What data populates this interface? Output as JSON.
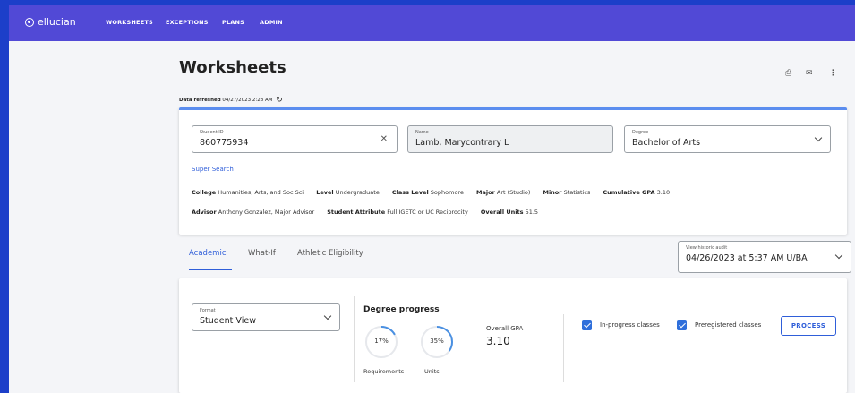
{
  "brand": {
    "name": "ellucian"
  },
  "nav": {
    "items": [
      "WORKSHEETS",
      "EXCEPTIONS",
      "PLANS",
      "ADMIN"
    ]
  },
  "page": {
    "title": "Worksheets",
    "refreshed_label": "Data refreshed",
    "refreshed_value": "04/27/2023 2:28 AM"
  },
  "student": {
    "id_label": "Student ID",
    "id_value": "860775934",
    "name_label": "Name",
    "name_value": "Lamb, Marycontrary L",
    "degree_label": "Degree",
    "degree_value": "Bachelor of Arts",
    "super_search": "Super Search",
    "row1": [
      {
        "key": "College",
        "value": "Humanities, Arts, and Soc Sci"
      },
      {
        "key": "Level",
        "value": "Undergraduate"
      },
      {
        "key": "Class Level",
        "value": "Sophomore"
      },
      {
        "key": "Major",
        "value": "Art (Studio)"
      },
      {
        "key": "Minor",
        "value": "Statistics"
      },
      {
        "key": "Cumulative GPA",
        "value": "3.10"
      }
    ],
    "row2": [
      {
        "key": "Advisor",
        "value": "Anthony Gonzalez, Major Advisor"
      },
      {
        "key": "Student Attribute",
        "value": "Full IGETC or UC Reciprocity"
      },
      {
        "key": "Overall Units",
        "value": "51.5"
      }
    ]
  },
  "tabs": {
    "items": [
      "Academic",
      "What-If",
      "Athletic Eligibility"
    ],
    "active": 0
  },
  "history": {
    "label": "View historic audit",
    "value": "04/26/2023 at 5:37 AM U/BA"
  },
  "audit": {
    "format_label": "Format",
    "format_value": "Student View",
    "progress_title": "Degree progress",
    "requirements_pct": "17%",
    "requirements_fraction": 0.17,
    "requirements_label": "Requirements",
    "units_pct": "35%",
    "units_fraction": 0.35,
    "units_label": "Units",
    "gpa_label": "Overall GPA",
    "gpa_value": "3.10",
    "inprogress_label": "In-progress classes",
    "preregistered_label": "Preregistered classes",
    "process_label": "PROCESS"
  },
  "colors": {
    "topbar": "#5149d6",
    "accent": "#2f5ed9",
    "outer": "#1c3fc9",
    "ring": "#4a90e2"
  }
}
